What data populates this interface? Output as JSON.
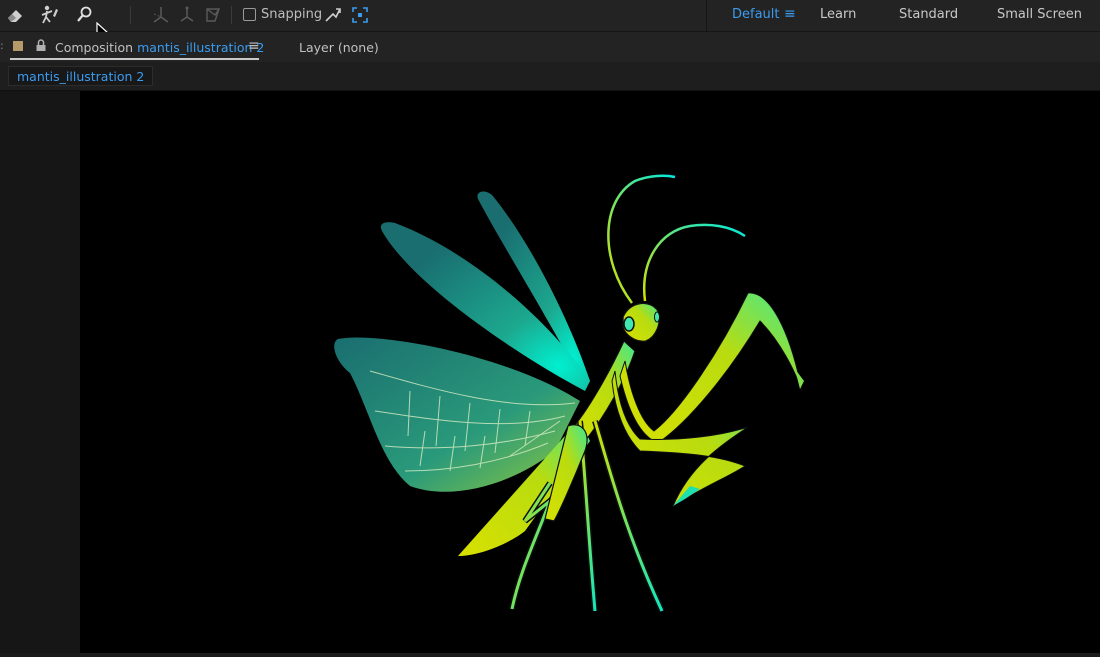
{
  "toolbar": {
    "tools": [
      "eraser-tool",
      "puppet-tool",
      "roto-brush-tool",
      "axis-local-tool",
      "axis-world-tool",
      "axis-view-tool"
    ],
    "snapping_label": "Snapping",
    "snapping_checked": false
  },
  "workspaces": {
    "items": [
      "Default",
      "Learn",
      "Standard",
      "Small Screen"
    ],
    "active": "Default"
  },
  "panels": {
    "composition_prefix": "Composition",
    "composition_name": "mantis_illustration 2",
    "layer_label": "Layer (none)"
  },
  "flowchart": {
    "active_comp": "mantis_illustration 2"
  },
  "colors": {
    "accent": "#3a9cf0",
    "panel_bg": "#232323",
    "canvas_bg": "#000000",
    "mantis_lime": "#c8e000",
    "mantis_cyan": "#00e8c8",
    "wing_teal": "#1f8a80"
  }
}
